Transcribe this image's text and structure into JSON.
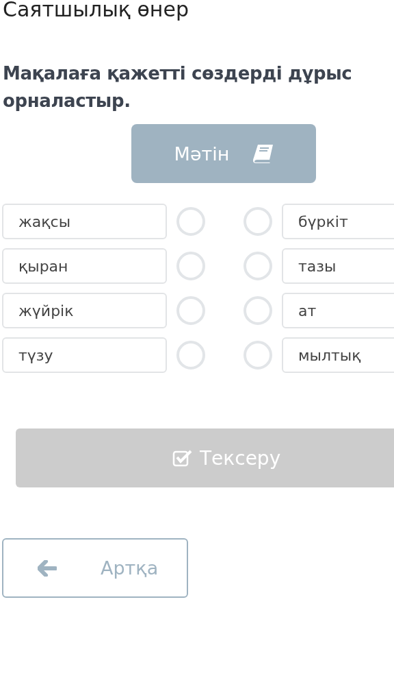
{
  "title": "Саятшылық өнер",
  "instruction": "Мақалаға қажетті сөздерді дұрыс орналастыр.",
  "text_button": {
    "label": "Мәтін"
  },
  "left_words": [
    {
      "text": "жақсы",
      "selected": false
    },
    {
      "text": "қыран",
      "selected": false
    },
    {
      "text": "жүйрік",
      "selected": false
    },
    {
      "text": "түзу",
      "selected": false
    }
  ],
  "right_words": [
    {
      "text": "бүркіт",
      "selected": false
    },
    {
      "text": "тазы",
      "selected": false
    },
    {
      "text": "ат",
      "selected": false
    },
    {
      "text": "мылтық",
      "selected": false
    }
  ],
  "check_button": {
    "label": "Тексеру",
    "disabled": true
  },
  "back_button": {
    "label": "Артқа"
  }
}
